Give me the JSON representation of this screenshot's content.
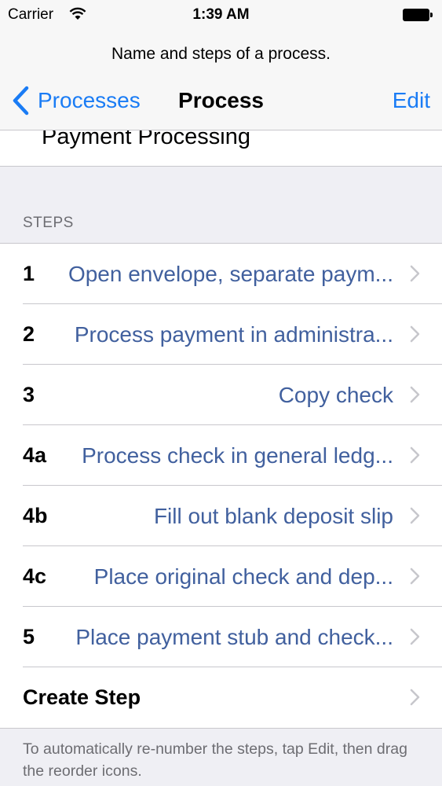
{
  "status_bar": {
    "carrier": "Carrier",
    "time": "1:39 AM",
    "icons": [
      "wifi-icon",
      "battery-icon"
    ]
  },
  "nav": {
    "prompt": "Name and steps of a process.",
    "back_label": "Processes",
    "title": "Process",
    "edit_label": "Edit",
    "tint_color": "#1a7cf5"
  },
  "process": {
    "name": "Payment Processing"
  },
  "steps_section": {
    "header": "STEPS",
    "steps": [
      {
        "number": "1",
        "title": "Open envelope, separate paym..."
      },
      {
        "number": "2",
        "title": "Process payment in administra..."
      },
      {
        "number": "3",
        "title": "Copy check"
      },
      {
        "number": "4a",
        "title": "Process check in general ledg..."
      },
      {
        "number": "4b",
        "title": "Fill out blank deposit slip"
      },
      {
        "number": "4c",
        "title": "Place original check and dep..."
      },
      {
        "number": "5",
        "title": "Place payment stub and check..."
      }
    ],
    "create_label": "Create Step",
    "step_text_color": "#41609e"
  },
  "footer": {
    "text": "To automatically re-number the steps, tap Edit, then drag the reorder icons."
  }
}
